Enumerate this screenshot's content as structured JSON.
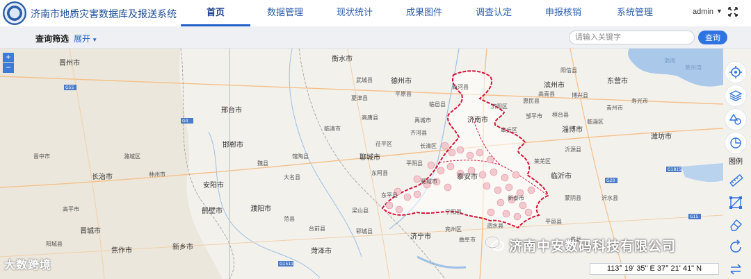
{
  "header": {
    "app_title": "济南市地质灾害数据库及报送系统",
    "nav": [
      {
        "label": "首页",
        "active": true
      },
      {
        "label": "数据管理",
        "active": false
      },
      {
        "label": "现状统计",
        "active": false
      },
      {
        "label": "成果图件",
        "active": false
      },
      {
        "label": "调查认定",
        "active": false
      },
      {
        "label": "申报核销",
        "active": false
      },
      {
        "label": "系统管理",
        "active": false
      }
    ],
    "user": "admin"
  },
  "filter": {
    "label": "查询筛选",
    "expand_label": "展开",
    "search_placeholder": "请输入关键字",
    "search_button": "查询"
  },
  "map": {
    "zoom_in": "+",
    "zoom_out": "−",
    "legend_label": "图例",
    "coordinates": "113° 19' 35\" E 37° 21' 41\" N",
    "tools": [
      "locate-icon",
      "layers-icon",
      "shapes-icon",
      "pie-chart-icon",
      "ruler-icon",
      "area-measure-icon",
      "eraser-icon",
      "refresh-icon",
      "swap-icon"
    ],
    "labels": {
      "jinan": "济南市",
      "taian": "泰安市",
      "zibo": "淄博市",
      "liaocheng": "聊城市",
      "dezhou": "德州市",
      "binzhou": "滨州市",
      "dongying": "东营市",
      "weifang": "潍坊市",
      "xingtai": "邢台市",
      "handan": "邯郸市",
      "anyang": "安阳市",
      "hebi": "鹤壁市",
      "puyang": "濮阳市",
      "heze": "菏泽市",
      "jining": "济宁市",
      "xinxiang": "新乡市",
      "jiaozuo": "焦作市",
      "changzhi": "长治市",
      "jincheng": "晋城市",
      "hengshui": "衡水市",
      "linyi": "临沂市",
      "shangqiu": "",
      "jinzhong": "晋中市",
      "laiwu": "莱芜区",
      "jingzhou": "晋州市",
      "chiping": "茌平区",
      "dongchangfu": "东阿县",
      "feicheng": "肥城市",
      "zhangqiu": "章丘区",
      "linqing": "临清市",
      "qingzhou": "青州市",
      "yishui": "沂水县",
      "zaozhuang": "",
      "qufu": "曲阜市",
      "yanzhou": "兖州区",
      "liangshan": "梁山县",
      "yuncheng": "郓城县",
      "shouguang": "寿光市",
      "boxing": "博兴县",
      "gaotang": "高唐县",
      "pingyuan": "平原县",
      "xiajin": "夏津县",
      "wucheng": "武城县",
      "guantao": "馆陶县",
      "daming": "大名县",
      "wei": "魏县",
      "linzhou": "林州市",
      "lucheng": "潞城区",
      "yangcheng": "阳城县",
      "gaoping": "高平市",
      "fanxian": "范县",
      "taiqian": "台前县",
      "dongping": "东平县",
      "pingyin": "平阴县",
      "changqing": "长清区",
      "qihe": "齐河县",
      "yucheng": "禹城市",
      "linyi_county": "临邑县",
      "shanghe": "商河县",
      "jiyang": "济阳区",
      "huimin": "惠民县",
      "yangxin": "阳信县",
      "zouping": "邹平市",
      "huantai": "桓台县",
      "gaoqing": "高青县",
      "linzi": "临淄区",
      "yiyuan": "沂源县",
      "mengyin": "蒙阴县",
      "xintai": "新泰市",
      "ningyang": "宁阳县",
      "sishui": "泗水县",
      "pingyi": "平邑县",
      "feixian": "费县",
      "tancheng": "",
      "bohai": "渤海",
      "laizhou": "莱州湾"
    }
  },
  "watermarks": {
    "left": "大数跨境",
    "right": "济南中安数码科技有限公司"
  },
  "colors": {
    "accent": "#2f73e0",
    "boundary": "#d6123a",
    "nav_text": "#2c5db0"
  }
}
